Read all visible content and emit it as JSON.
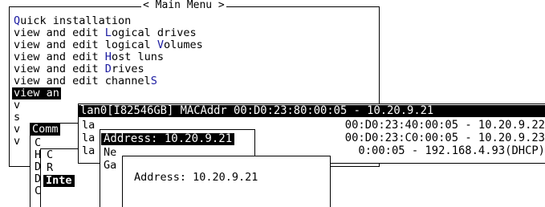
{
  "main_menu": {
    "title": "< Main Menu >",
    "items": [
      {
        "before": "",
        "hot": "Q",
        "after": "uick installation"
      },
      {
        "before": "view and edit ",
        "hot": "L",
        "after": "ogical drives"
      },
      {
        "before": "view and edit logical ",
        "hot": "V",
        "after": "olumes"
      },
      {
        "before": "view and edit ",
        "hot": "H",
        "after": "ost luns"
      },
      {
        "before": "view and edit ",
        "hot": "D",
        "after": "rives"
      },
      {
        "before": "view and edit channel",
        "hot": "S",
        "after": ""
      },
      {
        "text": "view an",
        "selected": true
      },
      {
        "text": "v"
      },
      {
        "text": "s"
      },
      {
        "text": "v"
      },
      {
        "text": "v"
      }
    ]
  },
  "comm_menu": {
    "label": "Comm",
    "items": [
      "C",
      "H",
      "D",
      "D",
      "C"
    ]
  },
  "sub_menu": {
    "items": [
      "C",
      "R",
      "Inte"
    ],
    "selected_index": 2
  },
  "lan_list": {
    "rows": [
      {
        "text": "lan0[I82546GB] MACAddr 00:D0:23:80:00:05 - 10.20.9.21",
        "selected": true
      },
      {
        "left": "la",
        "right": "00:D0:23:40:00:05 - 10.20.9.22"
      },
      {
        "left": "la",
        "right": "00:D0:23:C0:00:05 - 10.20.9.23"
      },
      {
        "left": "la",
        "right": "0:00:05 - 192.168.4.93(DHCP)"
      }
    ]
  },
  "option_menu": {
    "items": [
      "Address: 10.20.9.21",
      "Ne",
      "Ga"
    ],
    "selected_index": 0
  },
  "input_dialog": {
    "label": "Address: 10.20.9.21"
  }
}
